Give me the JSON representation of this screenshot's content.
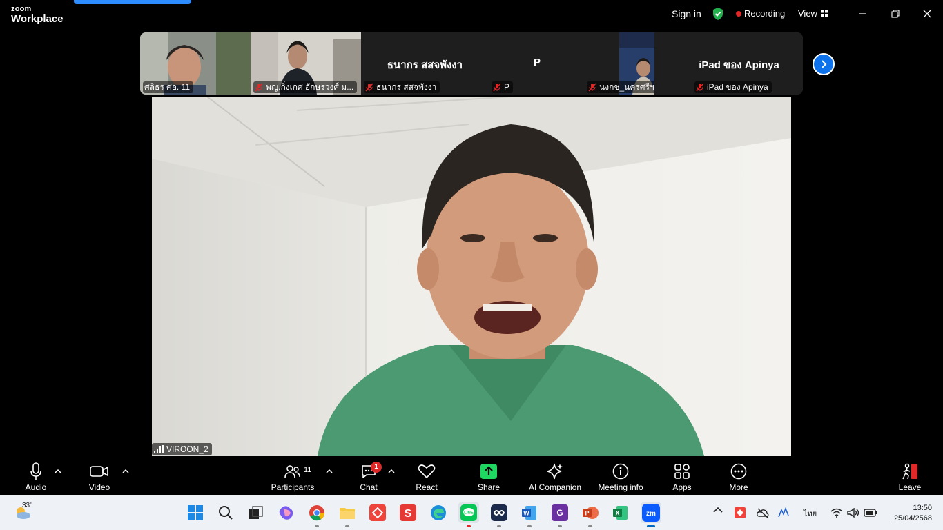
{
  "titlebar": {
    "brand_top": "zoom",
    "brand_bottom": "Workplace",
    "sign_in": "Sign in",
    "recording": "Recording",
    "view": "View"
  },
  "thumbnails": [
    {
      "name": "ศลิธร ศอ. 11",
      "muted": false,
      "video": true
    },
    {
      "name": "พญ.กิ่งเกศ อักษรวงศ์ ม...",
      "muted": true,
      "video": true
    },
    {
      "name": "ธนากร สสจพังงา",
      "big_label": "ธนากร สสจพังงา",
      "muted": true,
      "video": false
    },
    {
      "name": "P",
      "big_label": "P",
      "muted": true,
      "video": false
    },
    {
      "name": "นงกช_นครศรีฯ",
      "muted": true,
      "video": true
    },
    {
      "name": "iPad ของ Apinya",
      "big_label": "iPad ของ Apinya",
      "muted": true,
      "video": false
    }
  ],
  "main_video": {
    "name": "VIROON_2"
  },
  "toolbar": {
    "audio": "Audio",
    "video": "Video",
    "participants": "Participants",
    "participants_count": "11",
    "chat": "Chat",
    "chat_badge": "1",
    "react": "React",
    "share": "Share",
    "ai_companion": "AI Companion",
    "meeting_info": "Meeting info",
    "apps": "Apps",
    "more": "More",
    "leave": "Leave"
  },
  "taskbar": {
    "weather_temp": "33°",
    "language": "ไทย",
    "time": "13:50",
    "date": "25/04/2568"
  },
  "colors": {
    "accent": "#0e72ed",
    "share_green": "#1ed760",
    "recording_red": "#e02828"
  }
}
